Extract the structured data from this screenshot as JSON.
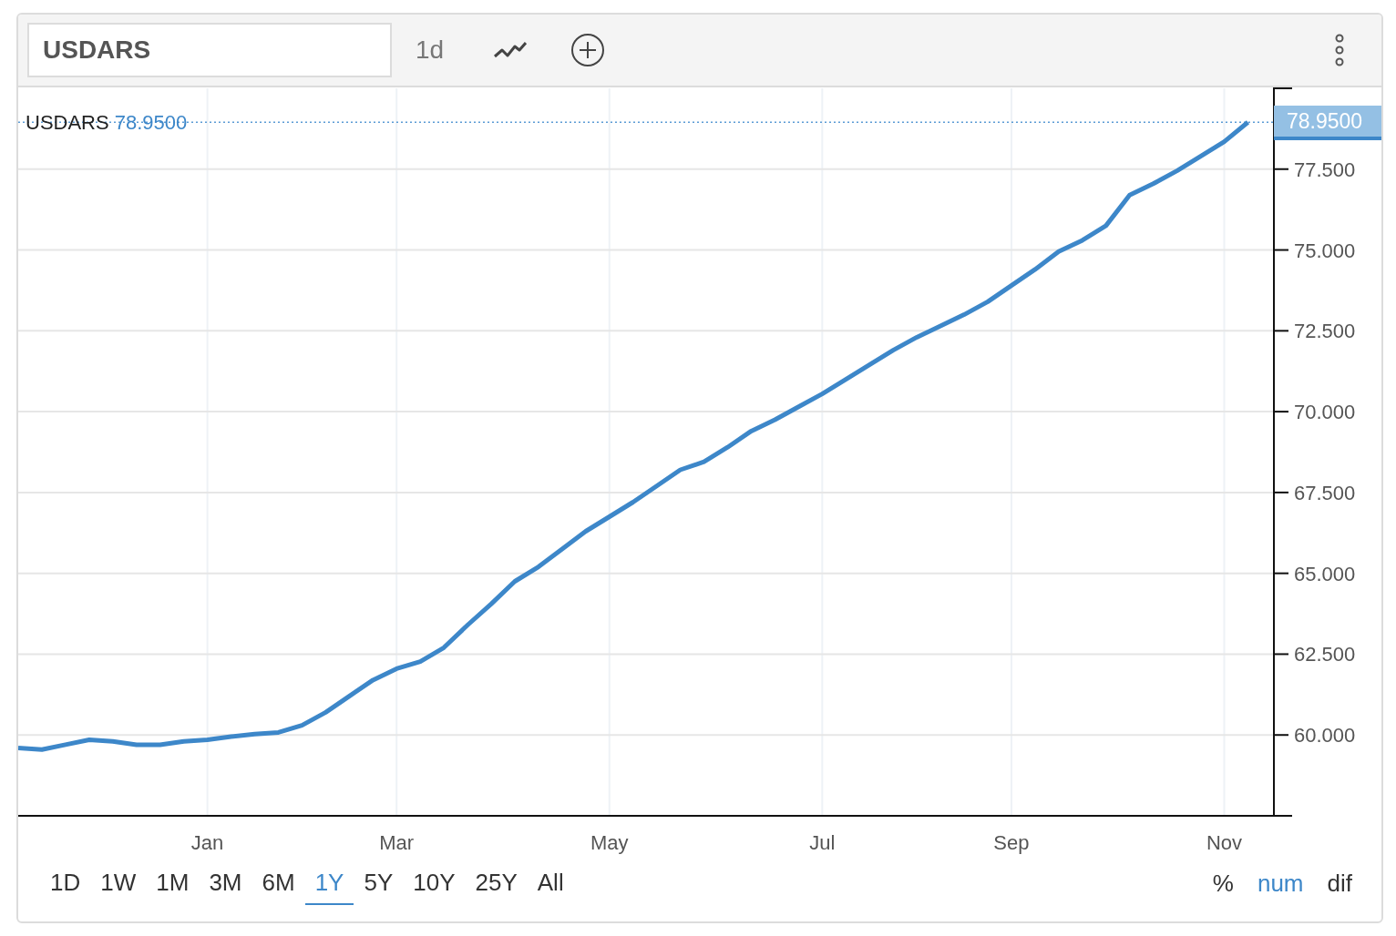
{
  "toolbar": {
    "symbol": "USDARS",
    "interval": "1d"
  },
  "legend": {
    "value": "78.9500"
  },
  "price_tag": "78.9500",
  "chart_data": {
    "type": "line",
    "categories": [
      null,
      null,
      null,
      null,
      null,
      null,
      null,
      null,
      "Jan",
      null,
      null,
      null,
      null,
      null,
      null,
      null,
      "Mar",
      null,
      null,
      null,
      null,
      null,
      null,
      null,
      null,
      "May",
      null,
      null,
      null,
      null,
      null,
      null,
      null,
      null,
      "Jul",
      null,
      null,
      null,
      null,
      null,
      null,
      null,
      "Sep",
      null,
      null,
      null,
      null,
      null,
      null,
      null,
      null,
      "Nov",
      null
    ],
    "series": [
      {
        "name": "USDARS",
        "color": "#3d87c9",
        "values": [
          59.6,
          59.55,
          59.7,
          59.85,
          59.8,
          59.7,
          59.7,
          59.8,
          59.85,
          59.95,
          60.03,
          60.08,
          60.3,
          60.7,
          61.2,
          61.7,
          62.05,
          62.27,
          62.7,
          63.4,
          64.05,
          64.75,
          65.2,
          65.75,
          66.3,
          66.75,
          67.2,
          67.7,
          68.2,
          68.45,
          68.9,
          69.4,
          69.75,
          70.15,
          70.55,
          71.0,
          71.45,
          71.9,
          72.3,
          72.65,
          73.0,
          73.4,
          73.9,
          74.4,
          74.95,
          75.3,
          75.75,
          76.7,
          77.05,
          77.45,
          77.9,
          78.35,
          78.95
        ]
      }
    ],
    "ylim": [
      57.5,
      80
    ],
    "grid": true,
    "ref_lines": [
      {
        "axis": "y",
        "value": 78.95
      }
    ],
    "yticks": [
      {
        "value": 60,
        "label": "60.000"
      },
      {
        "value": 62.5,
        "label": "62.500"
      },
      {
        "value": 65,
        "label": "65.000"
      },
      {
        "value": 67.5,
        "label": "67.500"
      },
      {
        "value": 70,
        "label": "70.000"
      },
      {
        "value": 72.5,
        "label": "72.500"
      },
      {
        "value": 75,
        "label": "75.000"
      },
      {
        "value": 77.5,
        "label": "77.500"
      }
    ]
  },
  "ranges": [
    {
      "label": "1D",
      "selected": false
    },
    {
      "label": "1W",
      "selected": false
    },
    {
      "label": "1M",
      "selected": false
    },
    {
      "label": "3M",
      "selected": false
    },
    {
      "label": "6M",
      "selected": false
    },
    {
      "label": "1Y",
      "selected": true
    },
    {
      "label": "5Y",
      "selected": false
    },
    {
      "label": "10Y",
      "selected": false
    },
    {
      "label": "25Y",
      "selected": false
    },
    {
      "label": "All",
      "selected": false
    }
  ],
  "modes": [
    {
      "label": "%",
      "selected": false
    },
    {
      "label": "num",
      "selected": true
    },
    {
      "label": "dif",
      "selected": false
    }
  ]
}
